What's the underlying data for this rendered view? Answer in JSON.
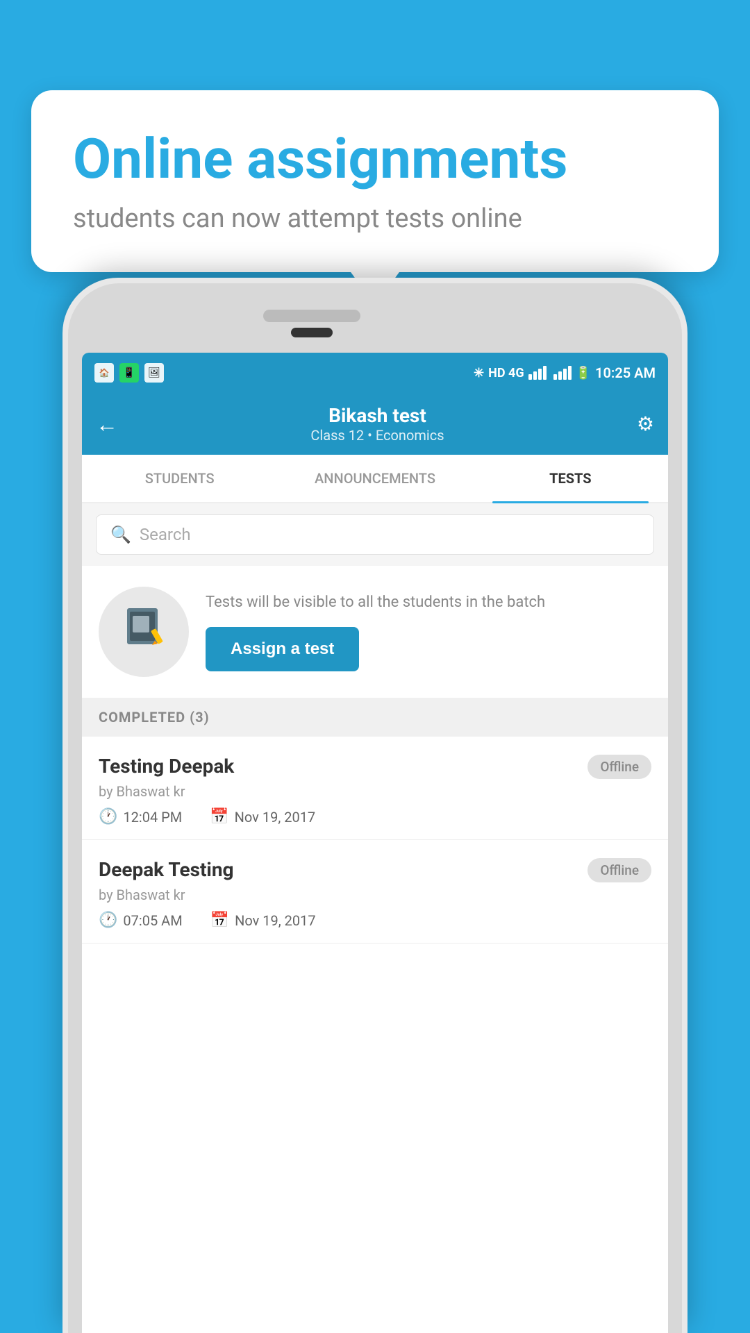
{
  "background": {
    "color": "#29abe2"
  },
  "speech_bubble": {
    "title": "Online assignments",
    "subtitle": "students can now attempt tests online"
  },
  "status_bar": {
    "time": "10:25 AM",
    "network": "HD 4G",
    "icons": [
      "app1",
      "whatsapp",
      "gallery"
    ]
  },
  "app_bar": {
    "title": "Bikash test",
    "subtitle": "Class 12 • Economics",
    "back_label": "←",
    "settings_label": "⚙"
  },
  "tabs": [
    {
      "label": "STUDENTS",
      "active": false
    },
    {
      "label": "ANNOUNCEMENTS",
      "active": false
    },
    {
      "label": "TESTS",
      "active": true
    }
  ],
  "search": {
    "placeholder": "Search"
  },
  "assign_section": {
    "description": "Tests will be visible to all the students in the batch",
    "button_label": "Assign a test",
    "icon": "📓"
  },
  "completed_section": {
    "header": "COMPLETED (3)",
    "items": [
      {
        "name": "Testing Deepak",
        "author": "by Bhaswat kr",
        "time": "12:04 PM",
        "date": "Nov 19, 2017",
        "badge": "Offline"
      },
      {
        "name": "Deepak Testing",
        "author": "by Bhaswat kr",
        "time": "07:05 AM",
        "date": "Nov 19, 2017",
        "badge": "Offline"
      }
    ]
  }
}
